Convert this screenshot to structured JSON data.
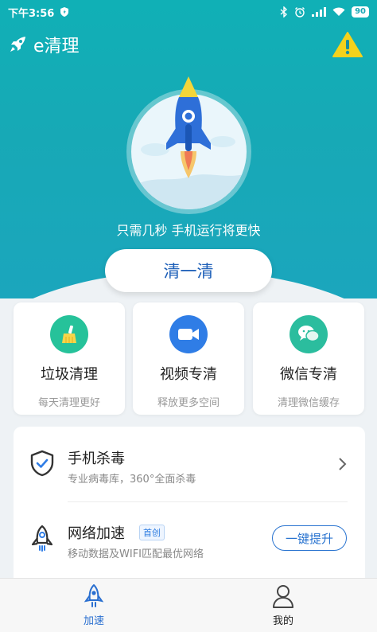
{
  "status_bar": {
    "time": "下午3:56",
    "battery": "90"
  },
  "app": {
    "title": "e清理",
    "warning_icon": "warning-icon"
  },
  "hero": {
    "tagline": "只需几秒 手机运行将更快",
    "clean_button": "清一清",
    "rocket_icon": "rocket-icon"
  },
  "features": [
    {
      "title": "垃圾清理",
      "subtitle": "每天清理更好",
      "icon": "broom-icon",
      "color": "#26c29a"
    },
    {
      "title": "视频专清",
      "subtitle": "释放更多空间",
      "icon": "video-icon",
      "color": "#2f7de6"
    },
    {
      "title": "微信专清",
      "subtitle": "清理微信缓存",
      "icon": "wechat-icon",
      "color": "#2bbd9e"
    }
  ],
  "list": [
    {
      "title": "手机杀毒",
      "subtitle": "专业病毒库，360°全面杀毒",
      "icon": "shield-check-icon"
    },
    {
      "title": "网络加速",
      "tag": "首创",
      "subtitle": "移动数据及WIFI匹配最优网络",
      "icon": "rocket-outline-icon",
      "action": "一键提升"
    }
  ],
  "tabs": [
    {
      "label": "加速",
      "icon": "rocket-tab-icon",
      "active": true
    },
    {
      "label": "我的",
      "icon": "user-icon",
      "active": false
    }
  ],
  "colors": {
    "accent": "#17a9b6",
    "primary_blue": "#1d5fb8"
  }
}
